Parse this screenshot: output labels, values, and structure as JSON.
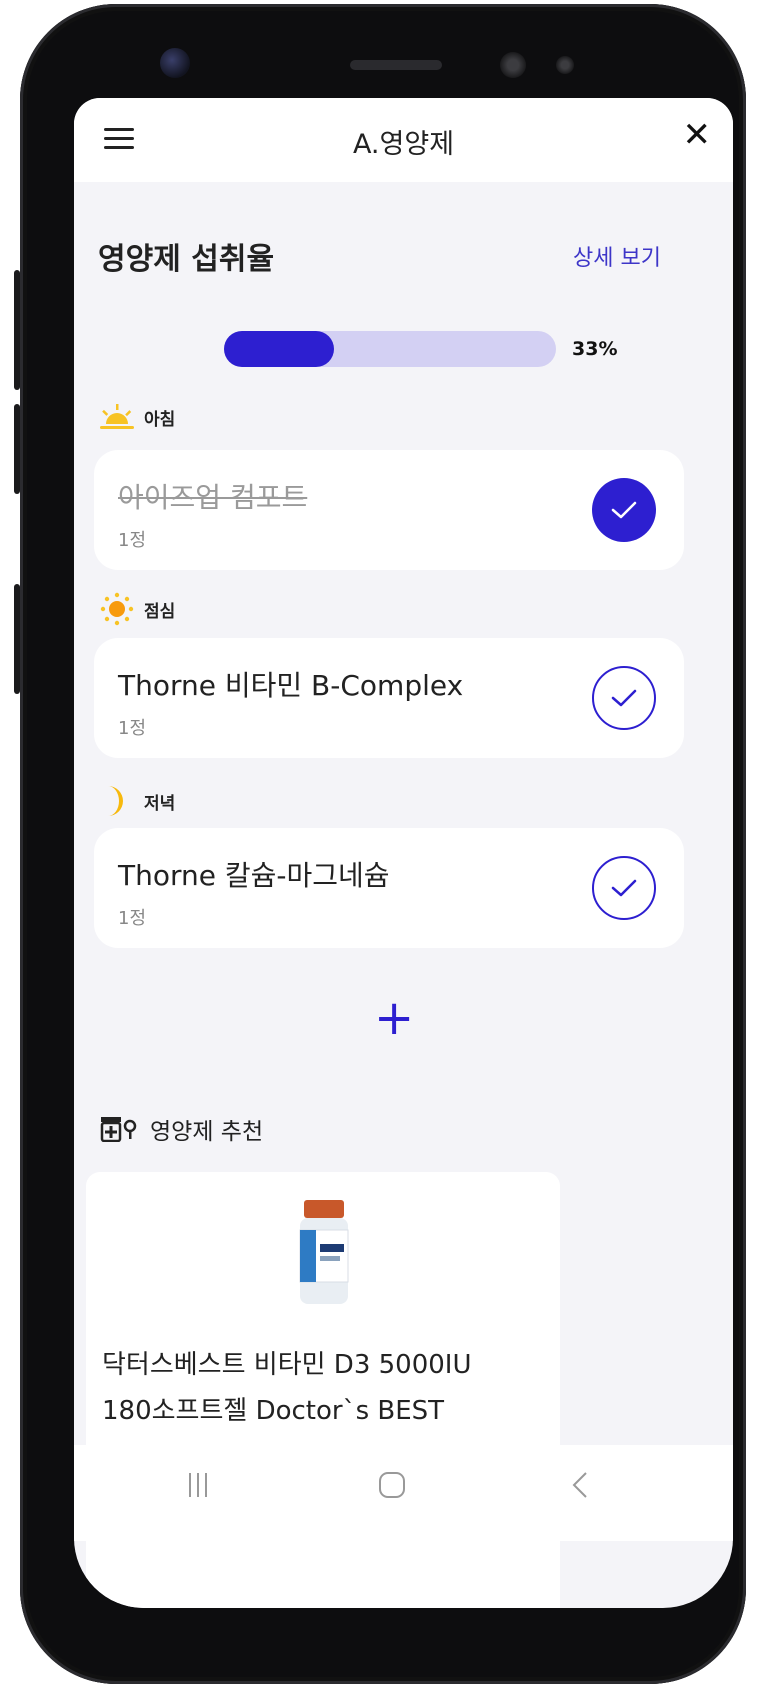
{
  "app": {
    "title": "A.영양제"
  },
  "intake": {
    "section_title": "영양제 섭취율",
    "detail_link": "상세 보기",
    "progress_fraction": 0.33,
    "progress_label": "33%"
  },
  "meals": [
    {
      "label": "아침",
      "icon": "sunrise-icon",
      "item": {
        "name": "아이즈업 컴포트",
        "qty": "1정",
        "taken": true
      }
    },
    {
      "label": "점심",
      "icon": "sun-icon",
      "item": {
        "name": "Thorne 비타민 B-Complex",
        "qty": "1정",
        "taken": false
      }
    },
    {
      "label": "저녁",
      "icon": "moon-icon",
      "item": {
        "name": "Thorne 칼슘-마그네슘",
        "qty": "1정",
        "taken": false
      }
    }
  ],
  "add_button": "+",
  "recommendation": {
    "title": "영양제 추천",
    "icon": "pill-bottle-icon",
    "product": {
      "line1": "닥터스베스트 비타민 D3 5000IU",
      "line2": "180소프트젤 Doctor`s BEST"
    }
  },
  "colors": {
    "accent": "#2d1fd0",
    "track": "#d3d0f3",
    "background": "#f4f4f8"
  },
  "navbar": {
    "recent_icon": "recent-apps-icon",
    "home_icon": "home-icon",
    "back_icon": "back-icon"
  }
}
